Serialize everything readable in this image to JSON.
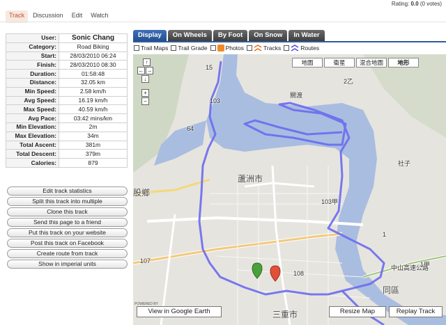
{
  "rating": {
    "label": "Rating:",
    "value": "0.0",
    "votes": "(0 votes)"
  },
  "tabs": [
    "Track",
    "Discussion",
    "Edit",
    "Watch"
  ],
  "stats": [
    {
      "key": "User:",
      "value": "Sonic Chang"
    },
    {
      "key": "Category:",
      "value": "Road Biking"
    },
    {
      "key": "Start:",
      "value": "28/03/2010 06:24"
    },
    {
      "key": "Finish:",
      "value": "28/03/2010 08:30"
    },
    {
      "key": "Duration:",
      "value": "01:58:48"
    },
    {
      "key": "Distance:",
      "value": "32.05 km"
    },
    {
      "key": "Min Speed:",
      "value": "2.58 km/h"
    },
    {
      "key": "Avg Speed:",
      "value": "16.19 km/h"
    },
    {
      "key": "Max Speed:",
      "value": "40.59 km/h"
    },
    {
      "key": "Avg Pace:",
      "value": "03:42 mins/km"
    },
    {
      "key": "Min Elevation:",
      "value": "2m"
    },
    {
      "key": "Max Elevation:",
      "value": "34m"
    },
    {
      "key": "Total Ascent:",
      "value": "381m"
    },
    {
      "key": "Total Descent:",
      "value": "379m"
    },
    {
      "key": "Calories:",
      "value": "879"
    }
  ],
  "actions": [
    "Edit track statistics",
    "Split this track into multiple",
    "Clone this track",
    "Send this page to a friend",
    "Put this track on your website",
    "Post this track on Facebook",
    "Create route from track",
    "Show in imperial units"
  ],
  "map_tabs": [
    "Display",
    "On Wheels",
    "By Foot",
    "On Snow",
    "In Water"
  ],
  "layers": {
    "trail_maps": "Trail Maps",
    "trail_grade": "Trail Grade",
    "photos": "Photos",
    "tracks": "Tracks",
    "routes": "Routes"
  },
  "map_types": [
    "地圖",
    "衛星",
    "混合地圖",
    "地形"
  ],
  "nav": {
    "up": "↑",
    "left": "←",
    "right": "→",
    "down": "↓",
    "zoom_in": "+",
    "zoom_out": "−"
  },
  "map_labels": {
    "luzhou": "蘆洲市",
    "sanchong": "三重市",
    "wugu": "股鄉",
    "datong": "同區",
    "shezi": "社子",
    "zhongshan": "中山高速公路",
    "guandu": "關渡",
    "road_103": "103",
    "road_103a": "103甲",
    "road_64": "64",
    "road_108": "108",
    "road_107": "107",
    "road_1": "1",
    "road_2z": "2乙",
    "road_1a": "1甲",
    "road_15": "15"
  },
  "map_buttons": {
    "google_earth": "View in Google Earth",
    "resize": "Resize Map",
    "replay": "Replay Track"
  },
  "powered_by": "POWERED BY",
  "colors": {
    "active_tab": "#c8502e",
    "map_tab_active": "#2f5b9d",
    "track": "#6a6af0",
    "water": "#a9bde0"
  }
}
